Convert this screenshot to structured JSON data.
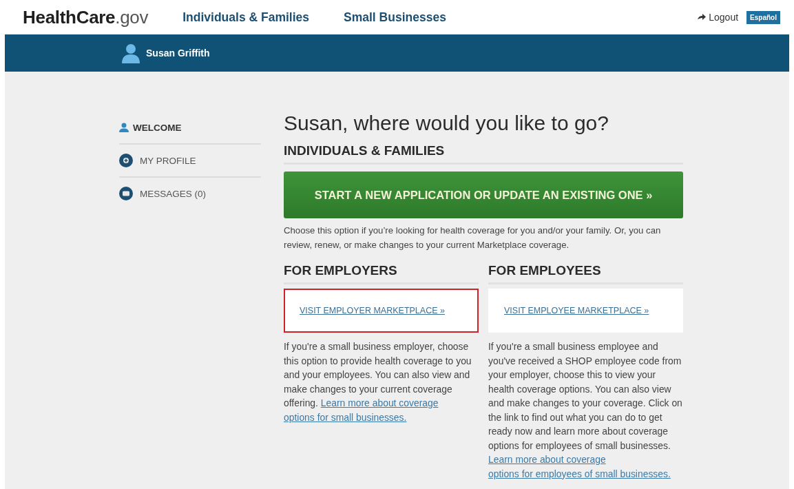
{
  "header": {
    "logo": {
      "main": "HealthCare",
      "suffix": ".gov"
    },
    "nav": [
      {
        "label": "Individuals & Families"
      },
      {
        "label": "Small Businesses"
      }
    ],
    "logout": "Logout",
    "language": "Español"
  },
  "user_bar": {
    "name": "Susan Griffith"
  },
  "sidebar": {
    "items": [
      {
        "label": "WELCOME",
        "kind": "person",
        "selected": true
      },
      {
        "label": "MY PROFILE",
        "kind": "profile",
        "selected": false
      },
      {
        "label": "MESSAGES (0)",
        "kind": "messages",
        "selected": false
      }
    ]
  },
  "main": {
    "title": "Susan, where would you like to go?",
    "individuals": {
      "heading": "INDIVIDUALS & FAMILIES",
      "button": "START A NEW APPLICATION OR UPDATE AN EXISTING ONE »",
      "description": "Choose this option if you’re looking for health coverage for you and/or your family. Or, you can review, renew, or make changes to your current Marketplace coverage."
    },
    "columns": [
      {
        "heading": "FOR EMPLOYERS",
        "link": "VISIT EMPLOYER MARKETPLACE »",
        "highlighted": true,
        "description": "If you're a small business employer, choose this option to provide health coverage to you and your employees. You can also view and make changes to your current coverage offering.",
        "learn_more": [
          "Learn more about coverage",
          "options for small businesses."
        ]
      },
      {
        "heading": "FOR EMPLOYEES",
        "link": "VISIT EMPLOYEE MARKETPLACE »",
        "highlighted": false,
        "description": "If you're a small business employee and you've received a SHOP employee code from your employer, choose this to view your health coverage options. You can also view and make changes to your coverage. Click on the link to find out what you can do to get ready now and learn more about coverage options for employees of small businesses.",
        "learn_more": [
          "Learn more about coverage",
          "options for employees of small businesses."
        ]
      }
    ]
  }
}
